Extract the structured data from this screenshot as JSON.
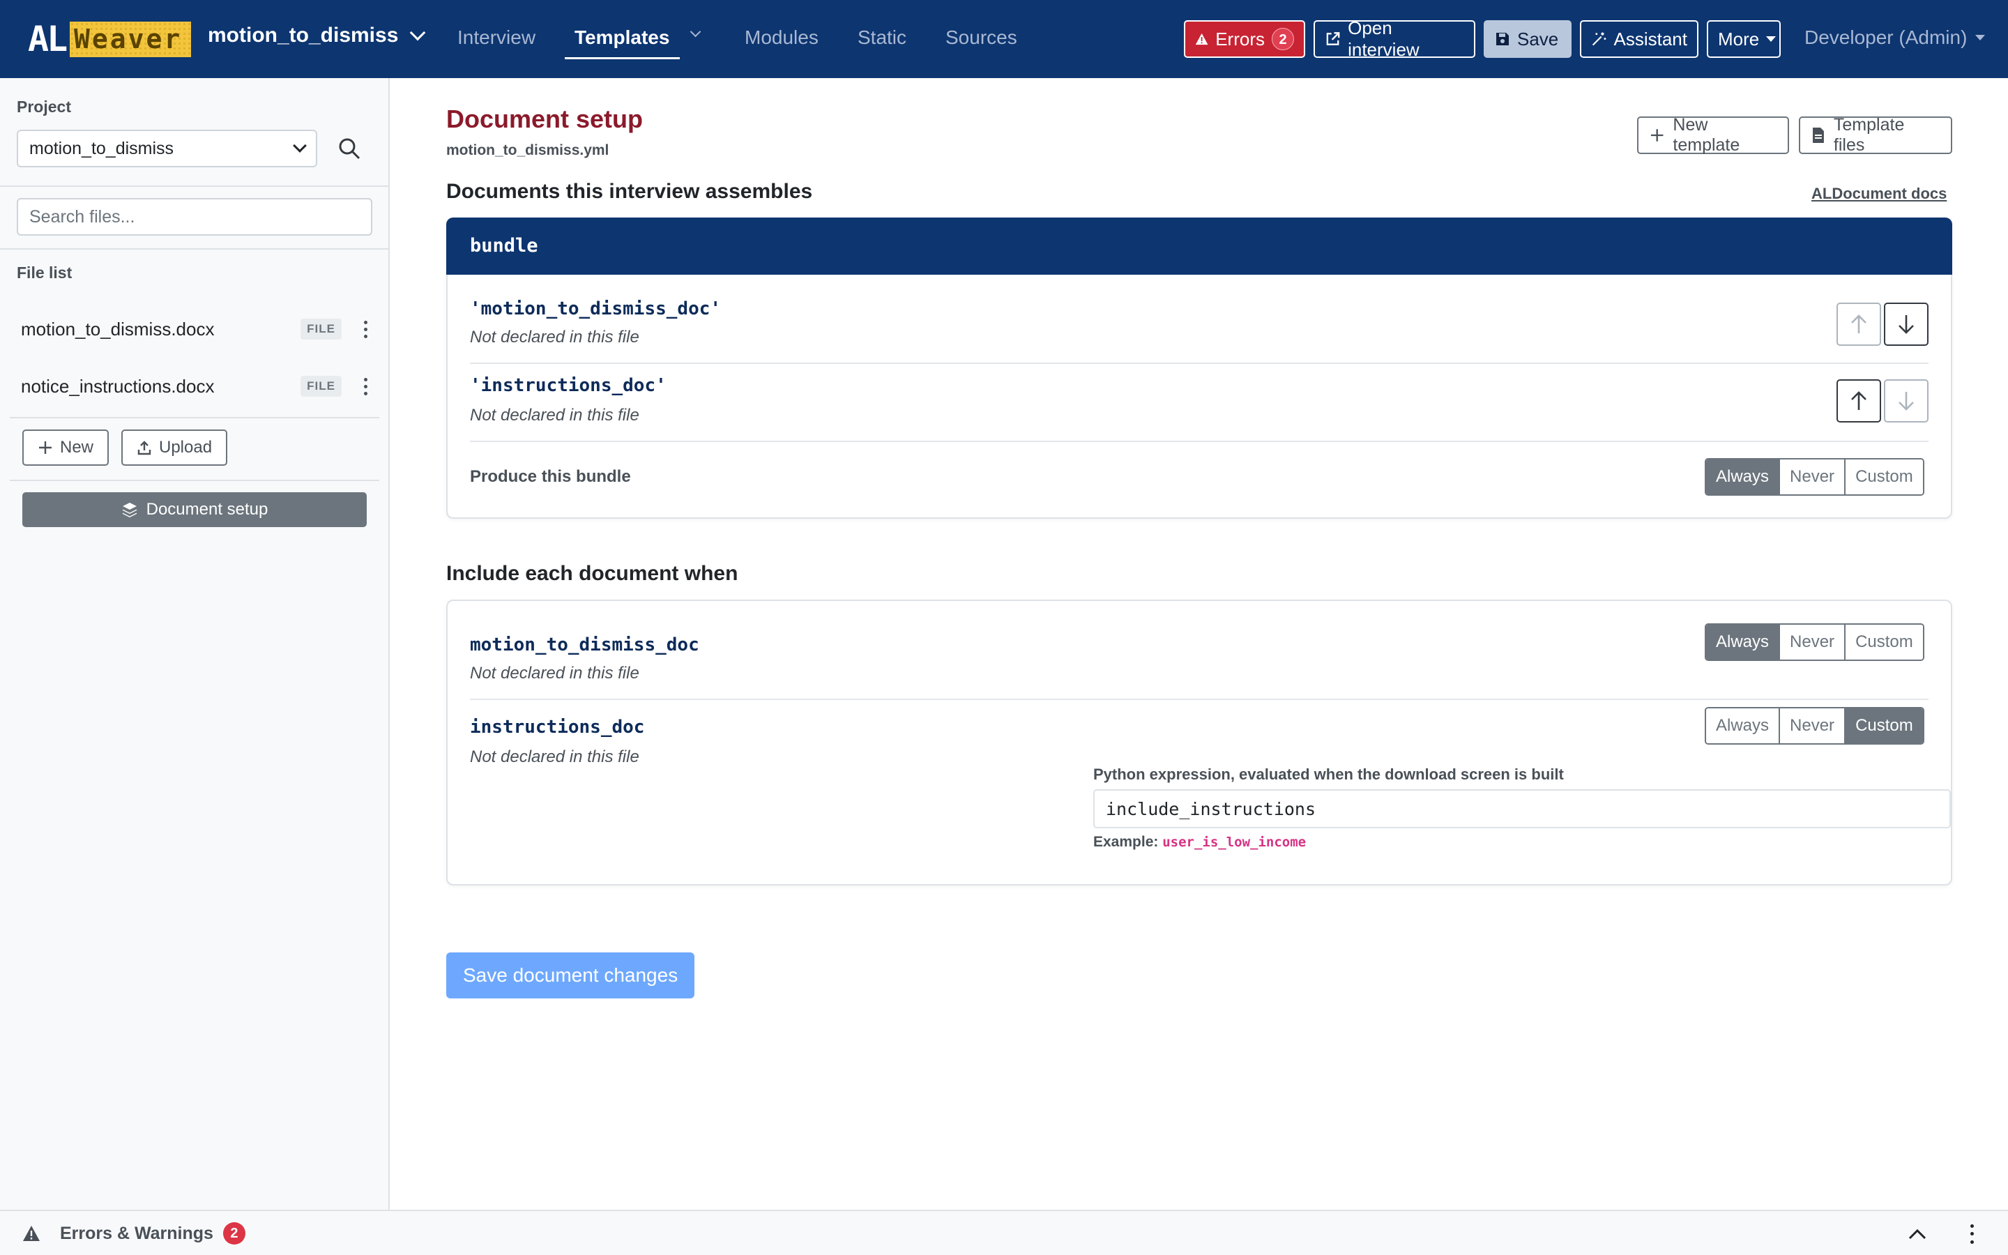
{
  "topbar": {
    "logo_al": "AL",
    "logo_word": "Weaver",
    "project_name": "motion_to_dismiss",
    "tabs": [
      {
        "label": "Interview"
      },
      {
        "label": "Templates"
      },
      {
        "label": "Modules"
      },
      {
        "label": "Static"
      },
      {
        "label": "Sources"
      }
    ],
    "errors_label": "Errors",
    "errors_count": "2",
    "open_interview_label": "Open interview",
    "save_label": "Save",
    "assistant_label": "Assistant",
    "more_label": "More",
    "user_label": "Developer (Admin)"
  },
  "sidebar": {
    "project_label": "Project",
    "project_selected": "motion_to_dismiss",
    "search_placeholder": "Search files...",
    "file_list_label": "File list",
    "files": [
      {
        "name": "motion_to_dismiss.docx",
        "badge": "FILE"
      },
      {
        "name": "notice_instructions.docx",
        "badge": "FILE"
      }
    ],
    "new_label": "New",
    "upload_label": "Upload",
    "document_setup_label": "Document setup"
  },
  "main": {
    "title": "Document setup",
    "subtitle": "motion_to_dismiss.yml",
    "new_template_label": "New template",
    "template_files_label": "Template files",
    "assembles_title": "Documents this interview assembles",
    "docs_link": "ALDocument docs",
    "bundle": {
      "name": "bundle",
      "items": [
        {
          "name": "'motion_to_dismiss_doc'",
          "note": "Not declared in this file"
        },
        {
          "name": "'instructions_doc'",
          "note": "Not declared in this file"
        }
      ],
      "produce_label": "Produce this bundle",
      "options": [
        "Always",
        "Never",
        "Custom"
      ],
      "selected": "Always"
    },
    "include_title": "Include each document when",
    "include_docs": [
      {
        "name": "motion_to_dismiss_doc",
        "note": "Not declared in this file",
        "selected": "Always"
      },
      {
        "name": "instructions_doc",
        "note": "Not declared in this file",
        "selected": "Custom"
      }
    ],
    "options": [
      "Always",
      "Never",
      "Custom"
    ],
    "expression_label": "Python expression, evaluated when the download screen is built",
    "expression_value": "include_instructions",
    "example_label": "Example:",
    "example_code": "user_is_low_income",
    "save_changes_label": "Save document changes"
  },
  "bottombar": {
    "label": "Errors & Warnings",
    "count": "2"
  },
  "colors": {
    "navy": "#0d3570",
    "title_red": "#8b1a2b",
    "error_red": "#c82333",
    "primary_blue": "#6ea8fe",
    "logo_yellow": "#f2c53d"
  }
}
